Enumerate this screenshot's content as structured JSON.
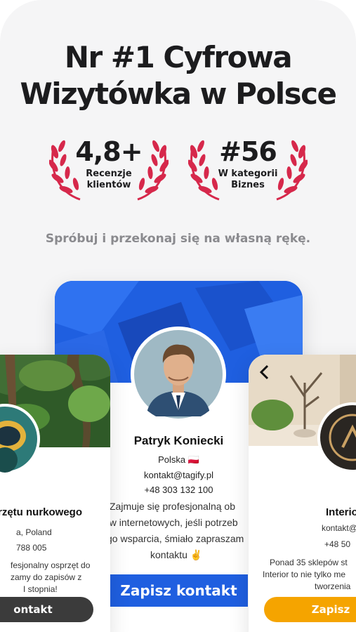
{
  "headline": {
    "line1": "Nr #1 Cyfrowa",
    "line2": "Wizytówka w Polsce"
  },
  "awards": [
    {
      "big": "4,8+",
      "small_line1": "Recenzje",
      "small_line2": "klientów"
    },
    {
      "big": "#56",
      "small_line1": "W kategorii",
      "small_line2": "Biznes"
    }
  ],
  "tagline": "Spróbuj i przekonaj się na własną rękę.",
  "center_card": {
    "name": "Patryk Koniecki",
    "country": "Polska 🇵🇱",
    "email": "kontakt@tagify.pl",
    "phone": "+48 303 132 100",
    "description": [
      "Zajmuje się profesjonalną ob",
      "ow internetowych, jeśli potrzeb",
      "go wsparcia, śmiało zapraszam",
      "kontaktu ✌️"
    ],
    "button": "Zapisz kontakt"
  },
  "left_card": {
    "name": "rzętu nurkowego",
    "location": "a, Poland",
    "phone": "788 005",
    "description": [
      "fesjonalny osprzęt do",
      "zamy do zapisów z",
      "I stopnia!"
    ],
    "button": "ontakt"
  },
  "right_card": {
    "name": "Interio",
    "email": "kontakt@",
    "phone": "+48 50",
    "description": [
      "Ponad 35 sklepów st",
      "Interior to nie tylko me",
      "tworzenia"
    ],
    "button": "Zapisz",
    "back_icon": "chevron-left-icon"
  },
  "colors": {
    "brand_blue": "#1f5fe0",
    "laurel_red": "#d6284b",
    "right_button": "#f5a400",
    "left_button": "#3b3b3b"
  }
}
